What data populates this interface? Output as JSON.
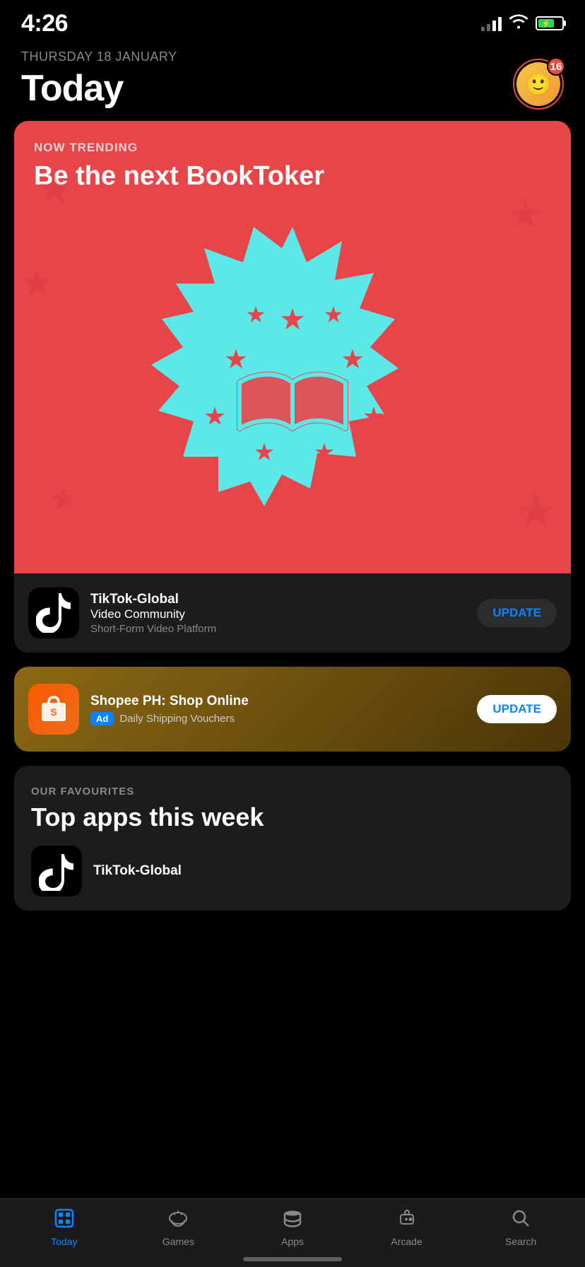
{
  "statusBar": {
    "time": "4:26",
    "batteryPercent": 70
  },
  "header": {
    "date": "THURSDAY 18 JANUARY",
    "title": "Today",
    "avatarEmoji": "🙂",
    "notificationCount": "16"
  },
  "trendingCard": {
    "label": "NOW TRENDING",
    "title": "Be the next BookToker"
  },
  "tiktokApp": {
    "name": "TikTok-Global",
    "subtitle": "Video Community",
    "category": "Short-Form Video Platform",
    "updateLabel": "UPDATE"
  },
  "shopeeAd": {
    "name": "Shopee PH: Shop Online",
    "adBadge": "Ad",
    "subtitle": "Daily Shipping Vouchers",
    "updateLabel": "UPDATE"
  },
  "favourites": {
    "label": "OUR FAVOURITES",
    "title": "Top apps this week",
    "featuredApp": "TikTok-Global"
  },
  "tabBar": {
    "tabs": [
      {
        "id": "today",
        "label": "Today",
        "icon": "📋",
        "active": true
      },
      {
        "id": "games",
        "label": "Games",
        "icon": "🚀",
        "active": false
      },
      {
        "id": "apps",
        "label": "Apps",
        "icon": "🗂",
        "active": false
      },
      {
        "id": "arcade",
        "label": "Arcade",
        "icon": "🕹",
        "active": false
      },
      {
        "id": "search",
        "label": "Search",
        "icon": "🔍",
        "active": false
      }
    ]
  }
}
